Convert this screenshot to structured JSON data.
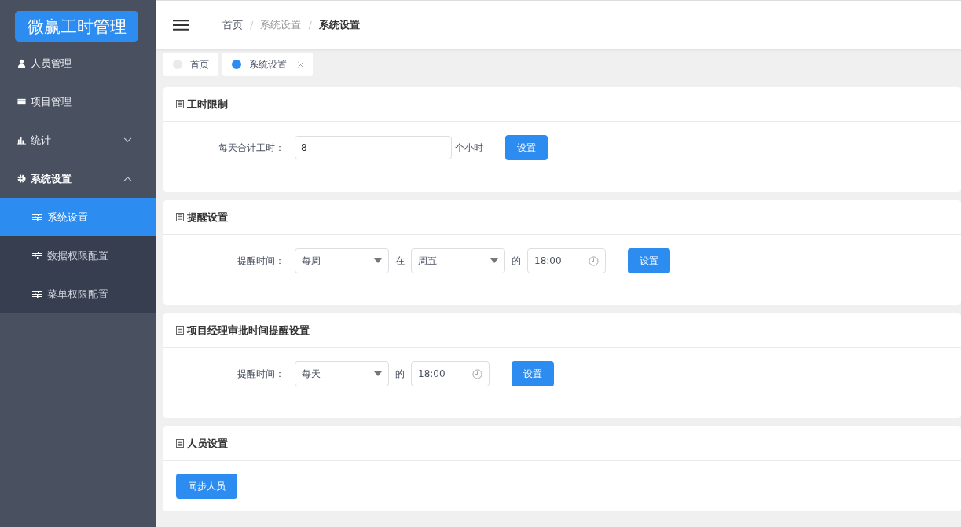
{
  "logo": "微赢工时管理",
  "sidebar": {
    "items": [
      {
        "label": "人员管理"
      },
      {
        "label": "项目管理"
      },
      {
        "label": "统计",
        "expanded": false
      },
      {
        "label": "系统设置",
        "expanded": true,
        "children": [
          {
            "label": "系统设置",
            "selected": true
          },
          {
            "label": "数据权限配置",
            "selected": false
          },
          {
            "label": "菜单权限配置",
            "selected": false
          }
        ]
      }
    ]
  },
  "breadcrumb": {
    "separator": "/",
    "items": [
      {
        "label": "首页",
        "current": false,
        "muted": false
      },
      {
        "label": "系统设置",
        "current": false,
        "muted": true
      },
      {
        "label": "系统设置",
        "current": true,
        "muted": false
      }
    ]
  },
  "tabs": [
    {
      "label": "首页",
      "selected": false,
      "closable": false
    },
    {
      "label": "系统设置",
      "selected": true,
      "closable": true
    }
  ],
  "sections": [
    {
      "title": "工时限制",
      "label": "每天合计工时：",
      "controls": [
        {
          "kind": "input",
          "value": "8"
        },
        {
          "kind": "text",
          "value": "个小时"
        },
        {
          "kind": "button",
          "value": "设置"
        }
      ]
    },
    {
      "title": "提醒设置",
      "label": "提醒时间：",
      "controls": [
        {
          "kind": "select",
          "value": "每周"
        },
        {
          "kind": "text",
          "value": "在"
        },
        {
          "kind": "select",
          "value": "周五"
        },
        {
          "kind": "text",
          "value": "的"
        },
        {
          "kind": "time",
          "value": "18:00"
        },
        {
          "kind": "button",
          "value": "设置"
        }
      ]
    },
    {
      "title": "项目经理审批时间提醒设置",
      "label": "提醒时间：",
      "controls": [
        {
          "kind": "select",
          "value": "每天"
        },
        {
          "kind": "text",
          "value": "的"
        },
        {
          "kind": "time",
          "value": "18:00"
        },
        {
          "kind": "button",
          "value": "设置"
        }
      ]
    },
    {
      "title": "人员设置",
      "controls": [
        {
          "kind": "button",
          "value": "同步人员"
        }
      ]
    }
  ]
}
